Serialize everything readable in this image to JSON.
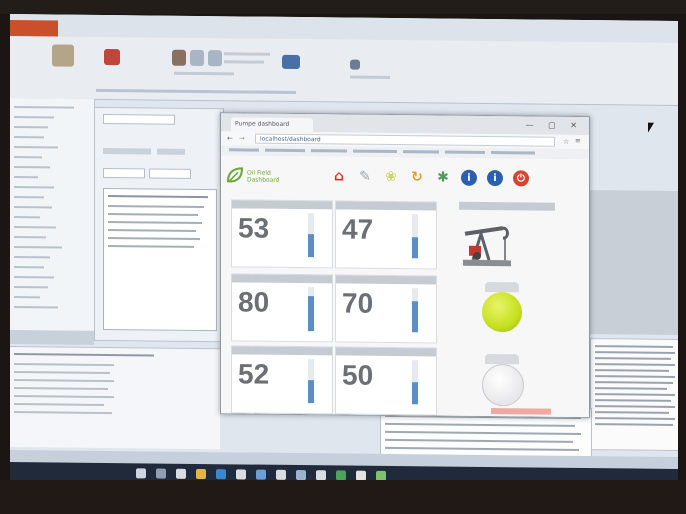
{
  "window": {
    "tab_title": "Pumpe dashboard",
    "address": "localhost/dashboard",
    "controls": "— ▢ ✕"
  },
  "logo": {
    "line1": "Oil Field",
    "line2": "Dashboard"
  },
  "toolbar_icons": [
    {
      "name": "home-icon",
      "color": "#d0342c",
      "glyph": "⌂"
    },
    {
      "name": "wrench-icon",
      "color": "#9aa4ad",
      "glyph": "✎"
    },
    {
      "name": "leaf-icon",
      "color": "#c9d66a",
      "glyph": "❀"
    },
    {
      "name": "refresh-icon",
      "color": "#e59a2d",
      "glyph": "↻"
    },
    {
      "name": "runner-icon",
      "color": "#4f9a57",
      "glyph": "✱"
    },
    {
      "name": "info-icon-1",
      "color": "#2c5fae",
      "glyph": "i"
    },
    {
      "name": "info-icon-2",
      "color": "#2c5fae",
      "glyph": "i"
    },
    {
      "name": "power-icon",
      "color": "#d6452f",
      "glyph": "⏻"
    }
  ],
  "cards": [
    {
      "value": "53",
      "level": 0.53
    },
    {
      "value": "47",
      "level": 0.47
    },
    {
      "value": "80",
      "level": 0.8
    },
    {
      "value": "70",
      "level": 0.7
    },
    {
      "value": "52",
      "level": 0.52
    },
    {
      "value": "50",
      "level": 0.5
    }
  ],
  "colors": {
    "gauge_fill": "#5c8fc0",
    "lamp_on": "#c6df1e",
    "lamp_off": "#e7e7e9",
    "ribbon_accent": "#c9502a"
  }
}
